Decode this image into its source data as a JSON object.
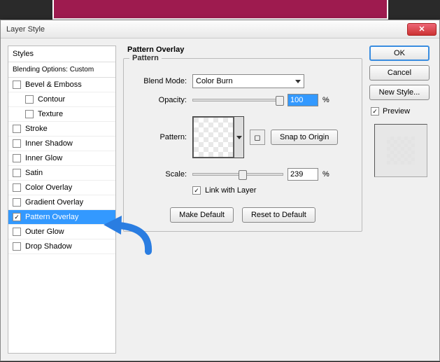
{
  "titlebar": {
    "title": "Layer Style"
  },
  "styles": {
    "header": "Styles",
    "subheader": "Blending Options: Custom",
    "items": [
      {
        "label": "Bevel & Emboss",
        "checked": false,
        "indent": false
      },
      {
        "label": "Contour",
        "checked": false,
        "indent": true
      },
      {
        "label": "Texture",
        "checked": false,
        "indent": true
      },
      {
        "label": "Stroke",
        "checked": false,
        "indent": false
      },
      {
        "label": "Inner Shadow",
        "checked": false,
        "indent": false
      },
      {
        "label": "Inner Glow",
        "checked": false,
        "indent": false
      },
      {
        "label": "Satin",
        "checked": false,
        "indent": false
      },
      {
        "label": "Color Overlay",
        "checked": false,
        "indent": false
      },
      {
        "label": "Gradient Overlay",
        "checked": false,
        "indent": false
      },
      {
        "label": "Pattern Overlay",
        "checked": true,
        "indent": false,
        "selected": true
      },
      {
        "label": "Outer Glow",
        "checked": false,
        "indent": false
      },
      {
        "label": "Drop Shadow",
        "checked": false,
        "indent": false
      }
    ]
  },
  "panel": {
    "section_title": "Pattern Overlay",
    "fieldset_title": "Pattern",
    "blend_mode": {
      "label": "Blend Mode:",
      "value": "Color Burn"
    },
    "opacity": {
      "label": "Opacity:",
      "value": "100",
      "unit": "%",
      "pct": 100
    },
    "pattern": {
      "label": "Pattern:",
      "snap_btn": "Snap to Origin"
    },
    "scale": {
      "label": "Scale:",
      "value": "239",
      "unit": "%",
      "pct": 55
    },
    "link": {
      "label": "Link with Layer",
      "checked": true
    },
    "make_default": "Make Default",
    "reset_default": "Reset to Default"
  },
  "right": {
    "ok": "OK",
    "cancel": "Cancel",
    "new_style": "New Style...",
    "preview": {
      "label": "Preview",
      "checked": true
    }
  }
}
